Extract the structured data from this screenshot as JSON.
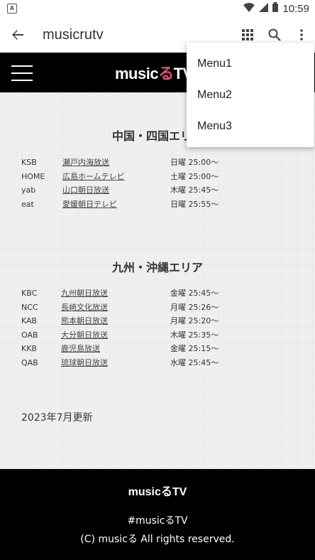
{
  "status_bar": {
    "time": "10:59",
    "notification_icon": "A"
  },
  "app_bar": {
    "title": "musicrutv"
  },
  "site": {
    "logo_prefix": "music",
    "logo_ru": "る",
    "logo_suffix": "TV"
  },
  "regions": [
    {
      "title": "中国・四国エリア",
      "stations": [
        {
          "code": "KSB",
          "name": "瀬戸内海放送",
          "time": "日曜 25:00〜"
        },
        {
          "code": "HOME",
          "name": "広島ホームテレビ",
          "time": "土曜 25:00〜"
        },
        {
          "code": "yab",
          "name": "山口朝日放送",
          "time": "木曜 25:45〜"
        },
        {
          "code": "eat",
          "name": "愛媛朝日テレビ",
          "time": "日曜 25:55〜"
        }
      ]
    },
    {
      "title": "九州・沖縄エリア",
      "stations": [
        {
          "code": "KBC",
          "name": "九州朝日放送",
          "time": "金曜 25:45〜"
        },
        {
          "code": "NCC",
          "name": "長崎文化放送",
          "time": "月曜 25:26〜"
        },
        {
          "code": "KAB",
          "name": "熊本朝日放送",
          "time": "月曜 25:20〜"
        },
        {
          "code": "OAB",
          "name": "大分朝日放送",
          "time": "木曜 25:35〜"
        },
        {
          "code": "KKB",
          "name": "鹿児島放送",
          "time": "金曜 25:15〜"
        },
        {
          "code": "QAB",
          "name": "琉球朝日放送",
          "time": "水曜 25:45〜"
        }
      ]
    }
  ],
  "updated_text": "2023年7月更新",
  "footer": {
    "tagline": "#musicるTV",
    "copyright": "(C) musicる All rights reserved."
  },
  "menu": {
    "items": [
      "Menu1",
      "Menu2",
      "Menu3"
    ]
  }
}
